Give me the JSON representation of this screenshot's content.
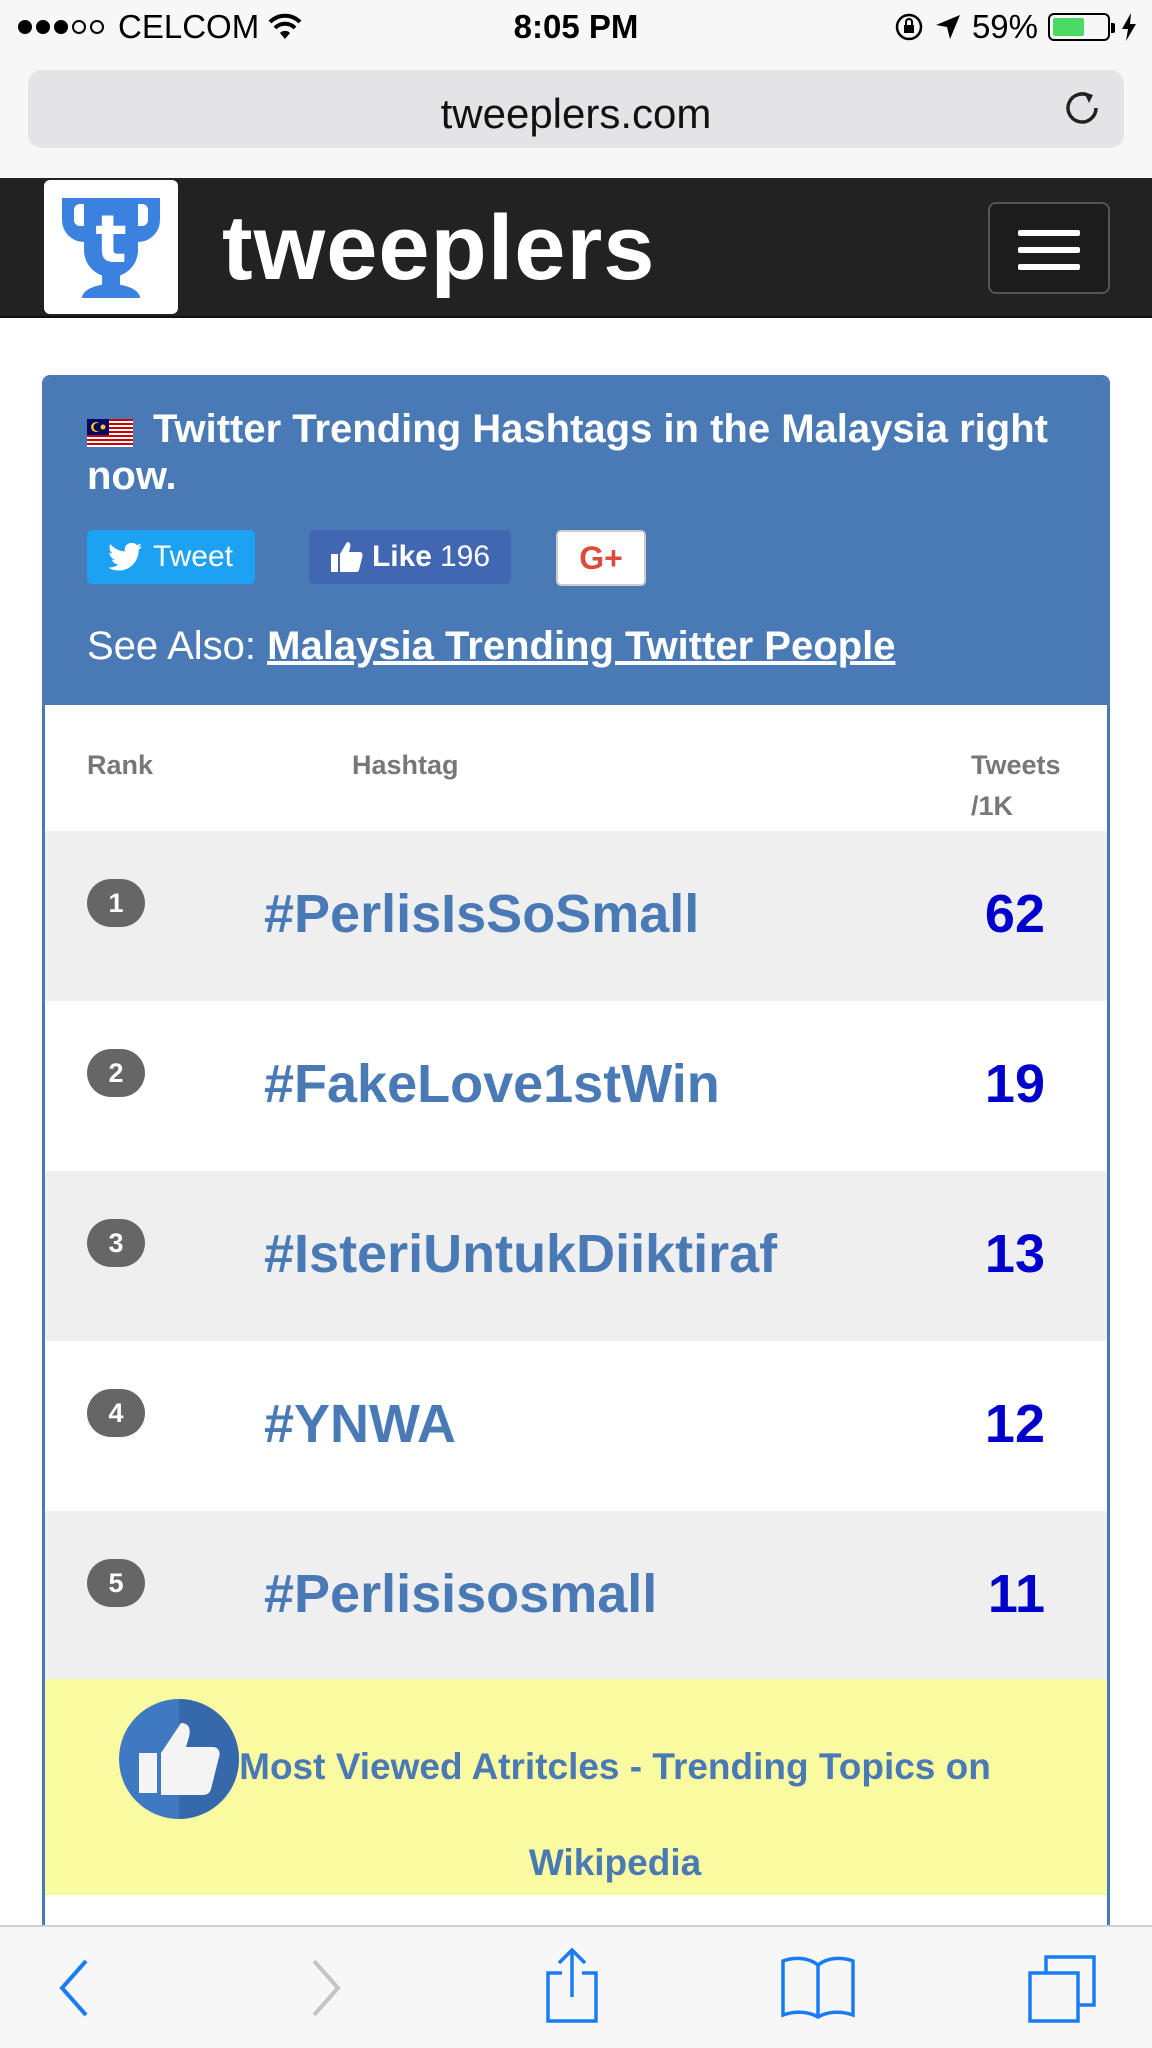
{
  "status_bar": {
    "carrier": "CELCOM",
    "time": "8:05 PM",
    "battery": "59%",
    "signal_icon": "signal-dots-icon",
    "wifi_icon": "wifi-icon",
    "battery_icon": "battery-icon"
  },
  "browser": {
    "url": "tweeplers.com",
    "reload_icon": "reload-icon"
  },
  "site": {
    "brand": "tweeplers",
    "logo_icon": "trophy-logo-icon",
    "menu_icon": "hamburger-menu-icon"
  },
  "panel": {
    "title": "Twitter Trending Hashtags in the Malaysia right now.",
    "flag_icon": "malaysia-flag-icon",
    "tweet_label": "Tweet",
    "like_label": "Like",
    "like_count": "196",
    "gplus_label": "G+",
    "see_also_prefix": "See Also:",
    "see_also_link": "Malaysia Trending Twitter People"
  },
  "table": {
    "columns": {
      "rank": "Rank",
      "hashtag": "Hashtag",
      "tweets_line1": "Tweets",
      "tweets_line2": "/1K"
    },
    "rows": [
      {
        "rank": "1",
        "hashtag": "#PerlisIsSoSmall",
        "tweets": "62"
      },
      {
        "rank": "2",
        "hashtag": "#FakeLove1stWin",
        "tweets": "19"
      },
      {
        "rank": "3",
        "hashtag": "#IsteriUntukDiiktiraf",
        "tweets": "13"
      },
      {
        "rank": "4",
        "hashtag": "#YNWA",
        "tweets": "12"
      },
      {
        "rank": "5",
        "hashtag": "#Perlisisosmall",
        "tweets": "11"
      }
    ]
  },
  "promo": {
    "text": "Most Viewed Atritcles - Trending Topics on Wikipedia",
    "icon": "thumbs-up-icon"
  },
  "toolbar": {
    "back_icon": "back-icon",
    "forward_icon": "forward-icon",
    "share_icon": "share-icon",
    "bookmarks_icon": "bookmarks-icon",
    "tabs_icon": "tabs-icon"
  },
  "colors": {
    "panel_blue": "#4a7ab5",
    "count_blue": "#0000cc",
    "header_dark": "#222222",
    "promo_yellow": "#fafaa0"
  }
}
